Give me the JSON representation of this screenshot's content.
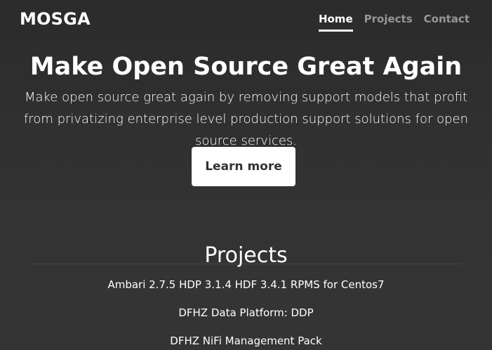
{
  "header": {
    "brand": "MOSGA",
    "nav": [
      {
        "label": "Home",
        "active": true
      },
      {
        "label": "Projects",
        "active": false
      },
      {
        "label": "Contact",
        "active": false
      }
    ]
  },
  "hero": {
    "title": "Make Open Source Great Again",
    "lead": "Make open source great again by removing support models that profit from privatizing enterprise level production support solutions for open source services.",
    "button_label": "Learn more"
  },
  "projects": {
    "title": "Projects",
    "items": [
      "Ambari 2.7.5 HDP 3.1.4 HDF 3.4.1 RPMS for Centos7",
      "DFHZ Data Platform: DDP",
      "DFHZ NiFi Management Pack"
    ]
  },
  "colors": {
    "background": "#333333",
    "text": "#ffffff",
    "muted_nav": "#8a8a8a",
    "button_bg": "#ffffff",
    "button_text": "#333333"
  }
}
